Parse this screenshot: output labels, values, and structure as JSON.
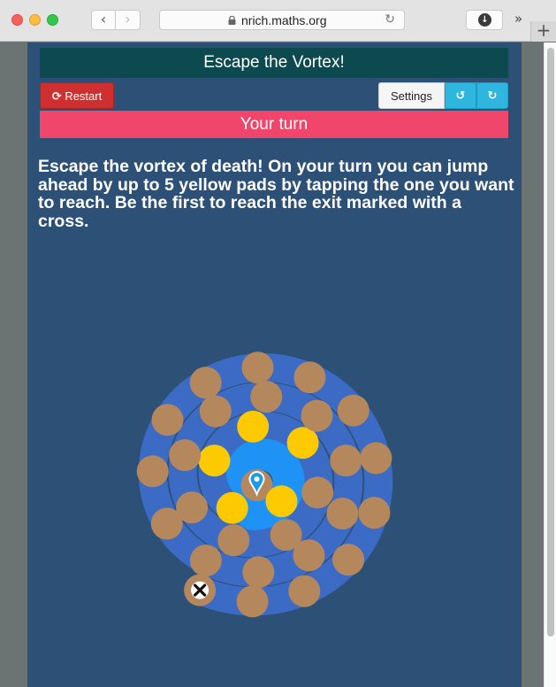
{
  "browser": {
    "url": "nrich.maths.org",
    "back_icon": "chevron-left-icon",
    "forward_icon": "chevron-right-icon",
    "reload_icon": "reload-icon",
    "download_icon": "download-icon",
    "overflow_icon": "chevrons-right-icon",
    "new_tab_icon": "plus-icon"
  },
  "game": {
    "title": "Escape the Vortex!",
    "restart_label": "Restart",
    "restart_icon": "refresh-icon",
    "settings_label": "Settings",
    "undo_icon": "undo-icon",
    "redo_icon": "redo-icon",
    "turn_status": "Your turn",
    "instructions": "Escape the vortex of death! On your turn you can jump ahead by up to 5 yellow pads by tapping the one you want to reach. Be the first to reach the exit marked with a cross.",
    "max_jump": 5,
    "exit_icon": "cross-icon",
    "player_icon": "map-marker-icon",
    "colors": {
      "background": "#2d5076",
      "spiral": "#3b6bc5",
      "highlight": "#1f93f5",
      "pad": "#b5875d",
      "reachable_pad": "#fdc901",
      "title_bar": "#0d4a4f",
      "turn_bar": "#f0466b",
      "restart": "#cf2f2e",
      "undo_redo": "#2eb6de"
    },
    "pads": [
      {
        "state": "player"
      },
      {
        "state": "reachable"
      },
      {
        "state": "reachable"
      },
      {
        "state": "reachable"
      },
      {
        "state": "reachable"
      },
      {
        "state": "reachable"
      },
      {
        "state": "normal"
      },
      {
        "state": "normal"
      },
      {
        "state": "normal"
      },
      {
        "state": "normal"
      },
      {
        "state": "normal"
      },
      {
        "state": "normal"
      },
      {
        "state": "normal"
      },
      {
        "state": "normal"
      },
      {
        "state": "normal"
      },
      {
        "state": "normal"
      },
      {
        "state": "normal"
      },
      {
        "state": "normal"
      },
      {
        "state": "normal"
      },
      {
        "state": "normal"
      },
      {
        "state": "normal"
      },
      {
        "state": "normal"
      },
      {
        "state": "normal"
      },
      {
        "state": "normal"
      },
      {
        "state": "normal"
      },
      {
        "state": "normal"
      },
      {
        "state": "normal"
      },
      {
        "state": "normal"
      },
      {
        "state": "normal"
      },
      {
        "state": "normal"
      },
      {
        "state": "normal"
      },
      {
        "state": "exit"
      }
    ]
  }
}
